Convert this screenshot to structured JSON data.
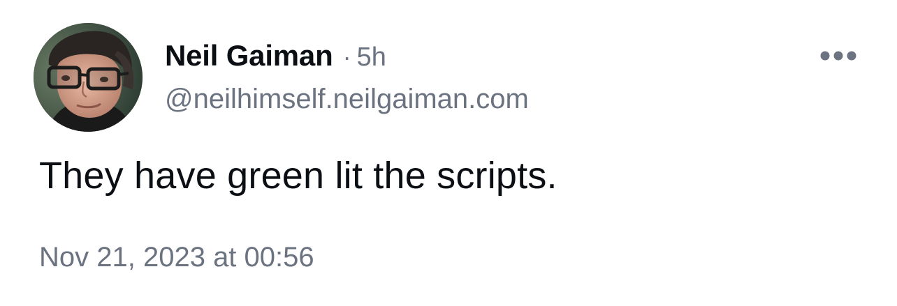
{
  "post": {
    "author": {
      "display_name": "Neil Gaiman",
      "handle": "@neilhimself.neilgaiman.com",
      "avatar": "profile-photo"
    },
    "separator": "·",
    "relative_time": "5h",
    "text": "They have green lit the scripts.",
    "timestamp": "Nov 21, 2023 at 00:56",
    "more_icon": "ellipsis-icon"
  },
  "colors": {
    "primary_text": "#0b0f14",
    "secondary_text": "#6b7280",
    "background": "#ffffff"
  }
}
